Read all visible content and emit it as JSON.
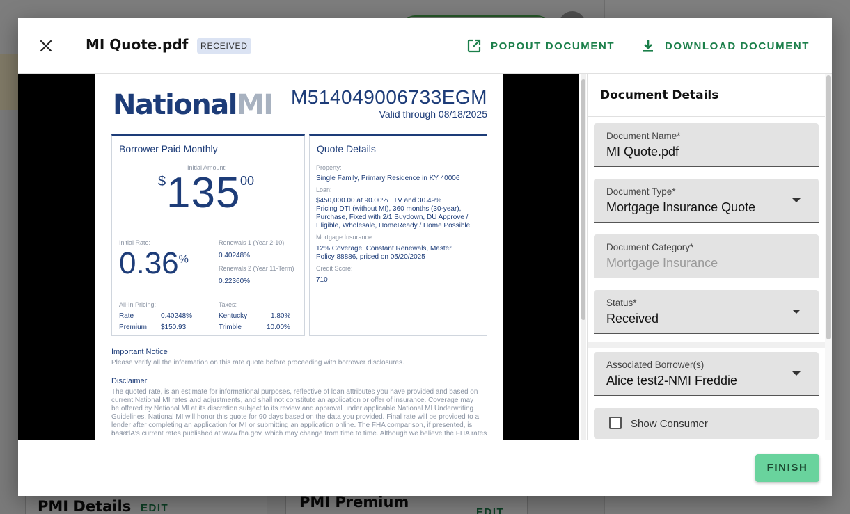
{
  "background": {
    "cards": [
      {
        "title": "PMI Details",
        "edit_label": "EDIT"
      },
      {
        "title": "PMI Premium",
        "edit_label": "EDIT"
      }
    ]
  },
  "modal": {
    "close_icon": "close-icon",
    "title": "MI Quote.pdf",
    "status_chip": "RECEIVED",
    "actions": {
      "popout": {
        "label": "POPOUT DOCUMENT",
        "icon": "open-in-new-icon"
      },
      "download": {
        "label": "DOWNLOAD DOCUMENT",
        "icon": "download-icon"
      }
    },
    "finish_label": "FINISH"
  },
  "pdf": {
    "logo_text": "National",
    "logo_mi": "MI",
    "quote_id": "M514049006733EGM",
    "valid_through": "Valid through 08/18/2025",
    "borrower_box": {
      "heading": "Borrower Paid Monthly",
      "initial_amount_label": "Initial Amount:",
      "amount_dollar_sign": "$",
      "amount_whole": "135",
      "amount_cents": "00",
      "initial_rate_label": "Initial Rate:",
      "initial_rate_value": "0.36",
      "initial_rate_unit": "%",
      "renewals1_label": "Renewals 1 (Year 2-10)",
      "renewals1_value": "0.40248%",
      "renewals2_label": "Renewals 2 (Year 11-Term)",
      "renewals2_value": "0.22360%",
      "allin_label": "All-In Pricing:",
      "taxes_label": "Taxes:",
      "rate_label": "Rate",
      "rate_value": "0.40248%",
      "premium_label": "Premium",
      "premium_value": "$150.93",
      "tax1_state": "Kentucky",
      "tax1_value": "1.80%",
      "tax2_state": "Trimble",
      "tax2_value": "10.00%"
    },
    "quote_box": {
      "heading": "Quote Details",
      "property_label": "Property:",
      "property_value": "Single Family, Primary Residence in KY 40006",
      "loan_label": "Loan:",
      "loan_lines": [
        "$450,000.00 at 90.00% LTV and 30.49%",
        "Pricing DTI (without MI), 360 months (30-year),",
        "Purchase, Fixed with 2/1 Buydown, DU Approve /",
        "Eligible, Wholesale, HomeReady / Home Possible"
      ],
      "mi_label": "Mortgage Insurance:",
      "mi_lines": [
        "12% Coverage, Constant Renewals, Master",
        "Policy 88886, priced on 05/20/2025"
      ],
      "credit_label": "Credit Score:",
      "credit_value": "710"
    },
    "important_notice_title": "Important Notice",
    "important_notice_text": "Please verify all the information on this rate quote before proceeding with borrower disclosures.",
    "disclaimer_title": "Disclaimer",
    "disclaimer_lines": [
      "The quoted rate, is an estimate for informational purposes, reflective of loan attributes you have provided and based on",
      "current National MI rates and adjustments, and shall not constitute an application or offer of insurance. Coverage may",
      "be offered by National MI at its discretion subject to its review and approval under applicable National MI Underwriting",
      "Guidelines. National MI will honor this quote for 90 days based on the data you provided. Final rate will be provided to a",
      "lender after completing an application for MI or submitting an application online. The FHA comparison, if presented, is based",
      "on FHA's current rates published at www.fha.gov, which may change from time to time. Although we believe the FHA rates"
    ]
  },
  "details": {
    "title": "Document Details",
    "fields": [
      {
        "label": "Document Name*",
        "value": "MI Quote.pdf"
      },
      {
        "label": "Document Type*",
        "value": "Mortgage Insurance Quote"
      },
      {
        "label": "Document Category*",
        "value": "Mortgage Insurance"
      },
      {
        "label": "Status*",
        "value": "Received"
      },
      {
        "label": "Associated Borrower(s)",
        "value": "Alice test2-NMI Freddie"
      }
    ],
    "show_consumer_label": "Show Consumer",
    "show_consumer_checked": false
  }
}
